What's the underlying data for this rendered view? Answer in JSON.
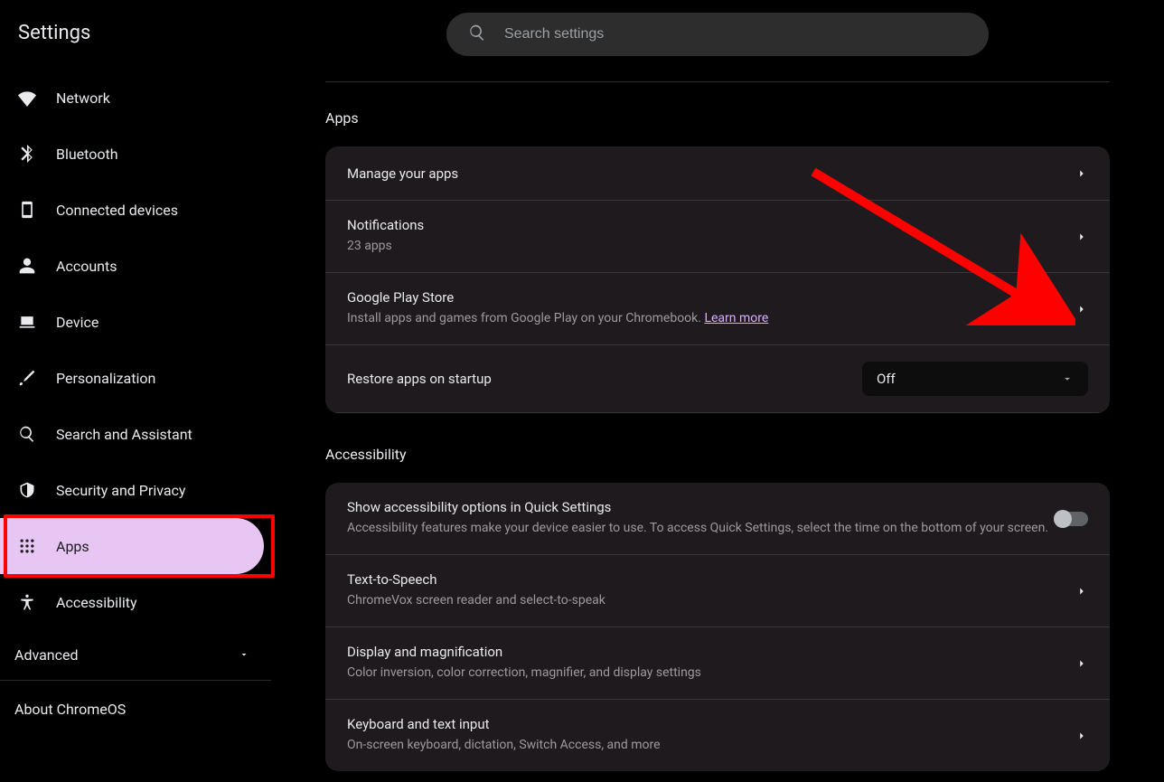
{
  "app_title": "Settings",
  "search": {
    "placeholder": "Search settings"
  },
  "sidebar": {
    "items": [
      {
        "id": "network",
        "label": "Network"
      },
      {
        "id": "bluetooth",
        "label": "Bluetooth"
      },
      {
        "id": "connected",
        "label": "Connected devices"
      },
      {
        "id": "accounts",
        "label": "Accounts"
      },
      {
        "id": "device",
        "label": "Device"
      },
      {
        "id": "personalization",
        "label": "Personalization"
      },
      {
        "id": "search-assist",
        "label": "Search and Assistant"
      },
      {
        "id": "security",
        "label": "Security and Privacy"
      },
      {
        "id": "apps",
        "label": "Apps",
        "selected": true
      },
      {
        "id": "accessibility",
        "label": "Accessibility"
      }
    ],
    "advanced": "Advanced",
    "about": "About ChromeOS"
  },
  "sections": {
    "apps": {
      "title": "Apps",
      "rows": {
        "manage": {
          "title": "Manage your apps"
        },
        "notifications": {
          "title": "Notifications",
          "sub": "23 apps"
        },
        "playstore": {
          "title": "Google Play Store",
          "sub": "Install apps and games from Google Play on your Chromebook. ",
          "learn": "Learn more"
        },
        "restore": {
          "title": "Restore apps on startup",
          "value": "Off"
        }
      }
    },
    "accessibility": {
      "title": "Accessibility",
      "rows": {
        "quicksettings": {
          "title": "Show accessibility options in Quick Settings",
          "sub": "Accessibility features make your device easier to use. To access Quick Settings, select the time on the bottom of your screen."
        },
        "tts": {
          "title": "Text-to-Speech",
          "sub": "ChromeVox screen reader and select-to-speak"
        },
        "display": {
          "title": "Display and magnification",
          "sub": "Color inversion, color correction, magnifier, and display settings"
        },
        "keyboard": {
          "title": "Keyboard and text input",
          "sub": "On-screen keyboard, dictation, Switch Access, and more"
        }
      }
    }
  }
}
